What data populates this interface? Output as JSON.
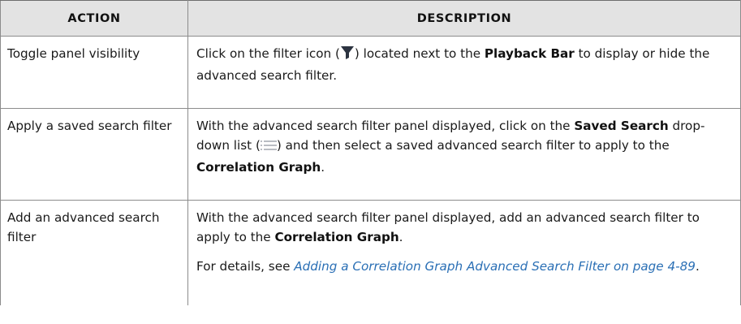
{
  "header": {
    "action": "Action",
    "description": "Description"
  },
  "rows": [
    {
      "action": "Toggle panel visibility",
      "desc_pre": "Click on the filter icon (",
      "desc_icon": "filter-icon",
      "desc_mid": ") located next to the ",
      "desc_bold": "Playback Bar",
      "desc_post": " to display or hide the advanced search filter."
    },
    {
      "action": "Apply a saved search filter",
      "desc_pre": "With the advanced search filter panel displayed, click on the ",
      "desc_bold1": "Saved Search",
      "desc_mid": " drop-down list (",
      "desc_icon": "list-icon",
      "desc_mid2": ") and then select a saved advanced search filter to apply to the ",
      "desc_bold2": "Correlation Graph",
      "desc_post": "."
    },
    {
      "action": "Add an advanced search filter",
      "desc_pre": "With the advanced search filter panel displayed, add an advanced search filter to apply to the ",
      "desc_bold": "Correlation Graph",
      "desc_post": ".",
      "details_pre": "For details, see ",
      "details_link": "Adding a Correlation Graph Advanced Search Filter on page 4-89",
      "details_post": "."
    }
  ],
  "colors": {
    "link": "#2a6fb5",
    "header_bg": "#e3e3e3",
    "border": "#8c8c8c"
  }
}
